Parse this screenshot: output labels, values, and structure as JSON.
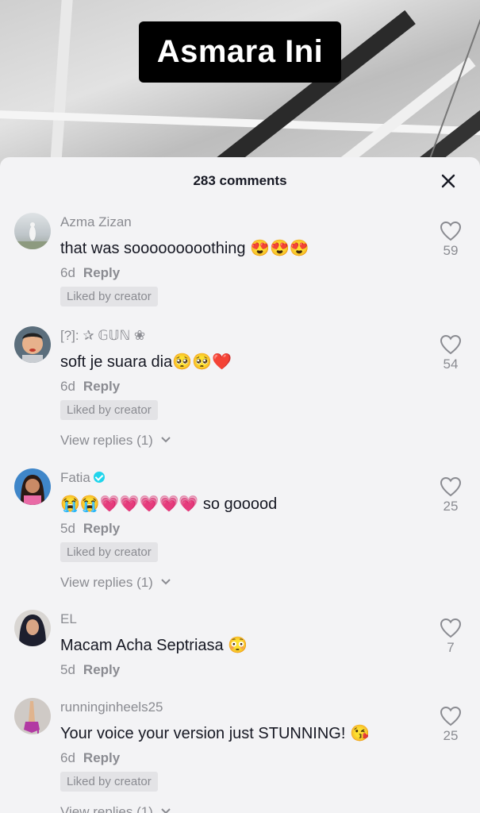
{
  "video": {
    "title": "Asmara Ini"
  },
  "sheet": {
    "count_label": "283 comments",
    "close_icon": "close-icon"
  },
  "comments": [
    {
      "user": "Azma Zizan",
      "text": "that was sooooooooothing 😍😍😍",
      "age": "6d",
      "reply": "Reply",
      "badge": "Liked by creator",
      "likes": "59",
      "view_replies": ""
    },
    {
      "user": "[?]: ✰ 𝔾𝕌ℕ ❀",
      "text": "soft je suara dia🥺🥺❤️",
      "age": "6d",
      "reply": "Reply",
      "badge": "Liked by creator",
      "likes": "54",
      "view_replies": "View replies (1)"
    },
    {
      "user": "Fatia",
      "verified": true,
      "text": "😭😭💗💗💗💗💗 so gooood",
      "age": "5d",
      "reply": "Reply",
      "badge": "Liked by creator",
      "likes": "25",
      "view_replies": "View replies (1)"
    },
    {
      "user": "EL",
      "text": "Macam Acha Septriasa 😳",
      "age": "5d",
      "reply": "Reply",
      "badge": "",
      "likes": "7",
      "view_replies": ""
    },
    {
      "user": "runninginheels25",
      "text": "Your voice your version just STUNNING! 😘",
      "age": "6d",
      "reply": "Reply",
      "badge": "Liked by creator",
      "likes": "25",
      "view_replies": "View replies (1)"
    }
  ],
  "colors": {
    "sheet_bg": "#f3f3f5",
    "muted": "#8a8b91",
    "text": "#161823",
    "verified": "#20d5ec"
  }
}
